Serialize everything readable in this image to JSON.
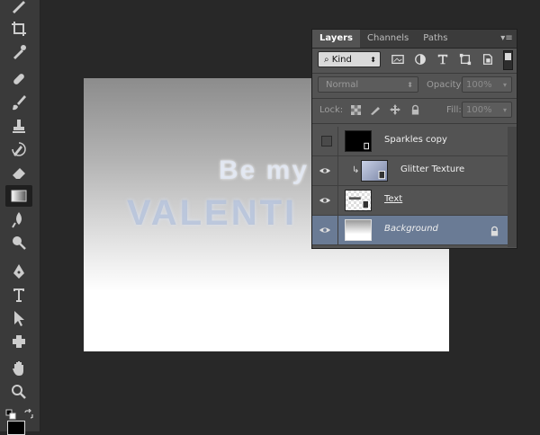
{
  "panel": {
    "tabs": [
      {
        "label": "Layers",
        "active": true
      },
      {
        "label": "Channels",
        "active": false
      },
      {
        "label": "Paths",
        "active": false
      }
    ],
    "filter": {
      "kind_label": "Kind",
      "icons": [
        "image-filter-icon",
        "adjustment-filter-icon",
        "type-filter-icon",
        "shape-filter-icon",
        "smart-object-filter-icon"
      ]
    },
    "blend_mode": "Normal",
    "opacity_label": "Opacity:",
    "opacity_value": "100%",
    "lock_label": "Lock:",
    "fill_label": "Fill:",
    "fill_value": "100%",
    "layers": [
      {
        "name": "Sparkles copy",
        "visible": false,
        "selected": false
      },
      {
        "name": "Glitter Texture",
        "visible": true,
        "selected": false,
        "clipped": true
      },
      {
        "name": "Text",
        "visible": true,
        "selected": false
      },
      {
        "name": "Background",
        "visible": true,
        "selected": true,
        "locked": true
      }
    ]
  },
  "canvas": {
    "line1": "Be my",
    "line2": "VALENTI"
  },
  "colors": {
    "app_bg": "#282828",
    "panel_bg": "#535353",
    "selected_layer": "#6a7b95",
    "foreground_color": "#000000"
  }
}
